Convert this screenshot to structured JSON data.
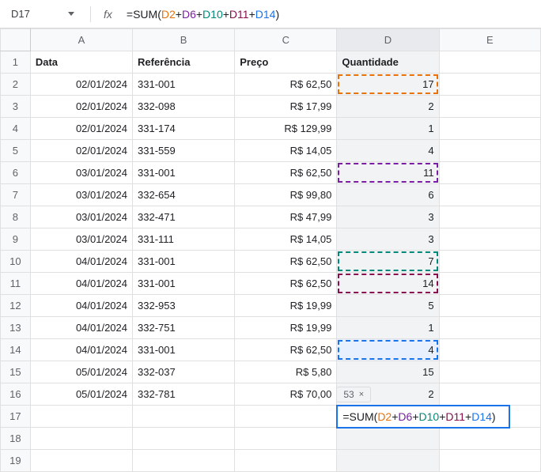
{
  "nameBox": "D17",
  "fxLabel": "fx",
  "formula": {
    "prefix": "=SUM",
    "openParen": "(",
    "closeParen": ")",
    "plus": "+",
    "refs": [
      "D2",
      "D6",
      "D10",
      "D11",
      "D14"
    ]
  },
  "hint": {
    "value": "53",
    "close": "×"
  },
  "cols": [
    "A",
    "B",
    "C",
    "D",
    "E"
  ],
  "headers": {
    "A": "Data",
    "B": "Referência",
    "C": "Preço",
    "D": "Quantidade"
  },
  "rows": [
    {
      "n": 2,
      "A": "02/01/2024",
      "B": "331-001",
      "C": "R$ 62,50",
      "D": "17"
    },
    {
      "n": 3,
      "A": "02/01/2024",
      "B": "332-098",
      "C": "R$ 17,99",
      "D": "2"
    },
    {
      "n": 4,
      "A": "02/01/2024",
      "B": "331-174",
      "C": "R$ 129,99",
      "D": "1"
    },
    {
      "n": 5,
      "A": "02/01/2024",
      "B": "331-559",
      "C": "R$ 14,05",
      "D": "4"
    },
    {
      "n": 6,
      "A": "03/01/2024",
      "B": "331-001",
      "C": "R$ 62,50",
      "D": "11"
    },
    {
      "n": 7,
      "A": "03/01/2024",
      "B": "332-654",
      "C": "R$ 99,80",
      "D": "6"
    },
    {
      "n": 8,
      "A": "03/01/2024",
      "B": "332-471",
      "C": "R$ 47,99",
      "D": "3"
    },
    {
      "n": 9,
      "A": "03/01/2024",
      "B": "331-111",
      "C": "R$ 14,05",
      "D": "3"
    },
    {
      "n": 10,
      "A": "04/01/2024",
      "B": "331-001",
      "C": "R$ 62,50",
      "D": "7"
    },
    {
      "n": 11,
      "A": "04/01/2024",
      "B": "331-001",
      "C": "R$ 62,50",
      "D": "14"
    },
    {
      "n": 12,
      "A": "04/01/2024",
      "B": "332-953",
      "C": "R$ 19,99",
      "D": "5"
    },
    {
      "n": 13,
      "A": "04/01/2024",
      "B": "332-751",
      "C": "R$ 19,99",
      "D": "1"
    },
    {
      "n": 14,
      "A": "04/01/2024",
      "B": "331-001",
      "C": "R$ 62,50",
      "D": "4"
    },
    {
      "n": 15,
      "A": "05/01/2024",
      "B": "332-037",
      "C": "R$ 5,80",
      "D": "15"
    },
    {
      "n": 16,
      "A": "05/01/2024",
      "B": "332-781",
      "C": "R$ 70,00",
      "D": "2"
    }
  ],
  "highlightMap": {
    "2": "orange",
    "6": "purple",
    "10": "teal",
    "11": "maroon",
    "14": "blue"
  },
  "emptyRows": [
    17,
    18,
    19
  ]
}
